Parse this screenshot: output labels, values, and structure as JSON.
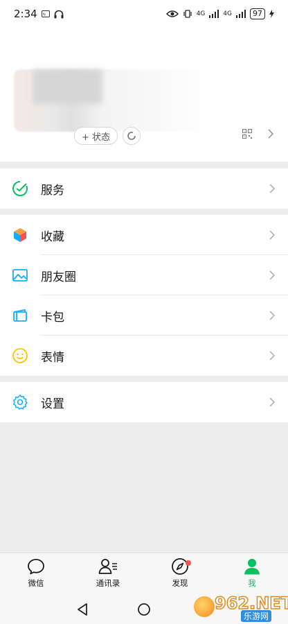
{
  "status_bar": {
    "time": "2:34",
    "net1": "4G",
    "net2": "4G",
    "battery": "97"
  },
  "profile": {
    "status_label": "+ 状态"
  },
  "menu": {
    "services": "服务",
    "favorites": "收藏",
    "moments": "朋友圈",
    "cards": "卡包",
    "stickers": "表情",
    "settings": "设置"
  },
  "tabs": [
    {
      "label": "微信",
      "icon": "chat-bubble-icon"
    },
    {
      "label": "通讯录",
      "icon": "contacts-icon"
    },
    {
      "label": "发现",
      "icon": "compass-icon"
    },
    {
      "label": "我",
      "icon": "person-icon"
    }
  ],
  "watermark": {
    "num": "962.NET",
    "cn": "乐游网"
  },
  "colors": {
    "accent": "#07c160",
    "badge": "#fa5151"
  }
}
